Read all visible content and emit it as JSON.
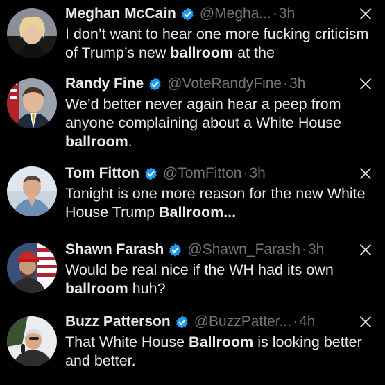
{
  "theme": {
    "background": "#000000",
    "text": "#e7e9ea",
    "muted": "#71767b",
    "verified": "#1d9bf0"
  },
  "tweets": [
    {
      "name": "Meghan McCain",
      "handle": "@Megha...",
      "time": "3h",
      "text_before": "I don’t want to hear one more fucking criticism of Trump’s new ",
      "bold": "ballroom",
      "text_after": " at the",
      "avatar_icon": "profile-photo"
    },
    {
      "name": "Randy Fine",
      "handle": "@VoteRandyFine",
      "time": "3h",
      "text_before": "We’d better never again hear a peep from anyone complaining about a White House ",
      "bold": "ballroom",
      "text_after": ".",
      "avatar_icon": "profile-photo"
    },
    {
      "name": "Tom Fitton",
      "handle": "@TomFitton",
      "time": "3h",
      "text_before": "Tonight is one more reason for the new White House Trump ",
      "bold": "Ballroom...",
      "text_after": "",
      "avatar_icon": "profile-photo"
    },
    {
      "name": "Shawn Farash",
      "handle": "@Shawn_Farash",
      "time": "3h",
      "text_before": "Would be real nice if the WH had its own ",
      "bold": "ballroom",
      "text_after": " huh?",
      "avatar_icon": "profile-photo"
    },
    {
      "name": "Buzz Patterson",
      "handle": "@BuzzPatter...",
      "time": "4h",
      "text_before": "That White House ",
      "bold": "Ballroom",
      "text_after": " is looking better and better.",
      "avatar_icon": "profile-photo"
    }
  ],
  "separator": "·"
}
